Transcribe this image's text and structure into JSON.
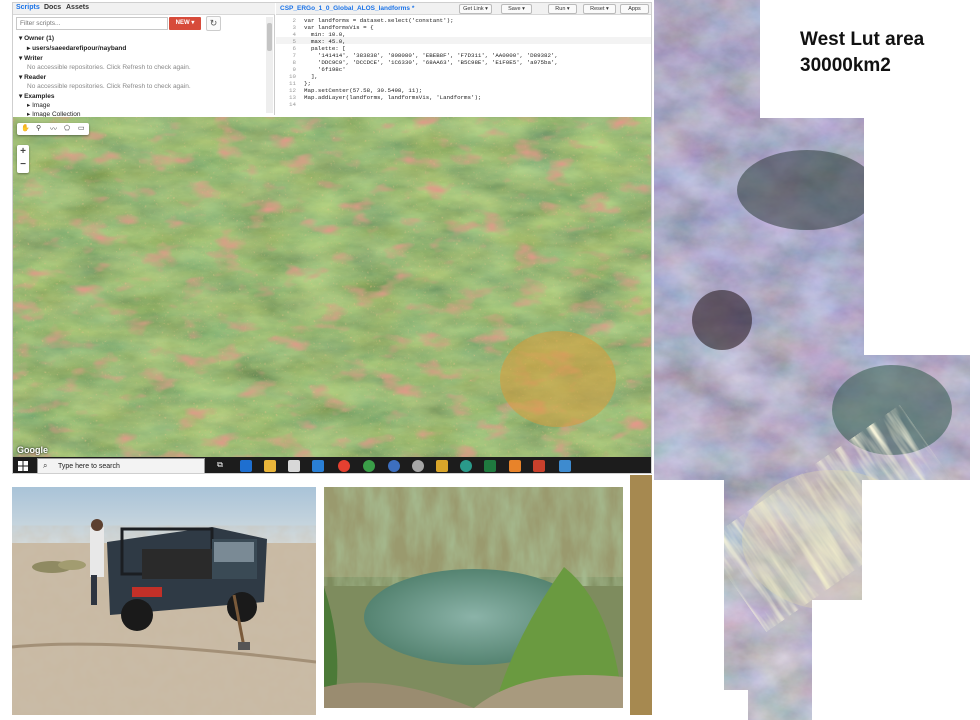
{
  "left_panel": {
    "tabs": [
      "Scripts",
      "Docs",
      "Assets"
    ],
    "filter_placeholder": "Filter scripts...",
    "new_label": "NEW",
    "tree": [
      {
        "text": "Owner (1)",
        "style": "b"
      },
      {
        "text": "users/saeedarefipour/nayband",
        "style": "i1 b"
      },
      {
        "text": "Writer",
        "style": "b"
      },
      {
        "text": "No accessible repositories. Click Refresh to check again.",
        "style": "g"
      },
      {
        "text": "Reader",
        "style": "b"
      },
      {
        "text": "No accessible repositories. Click Refresh to check again.",
        "style": "g"
      },
      {
        "text": "Examples",
        "style": "b"
      },
      {
        "text": "Image",
        "style": "i1"
      },
      {
        "text": "Image Collection",
        "style": "i1"
      }
    ]
  },
  "editor": {
    "file_name": "CSP_ERGo_1_0_Global_ALOS_landforms *",
    "buttons": [
      "Get Link",
      "Save",
      "Run",
      "Reset",
      "Apps"
    ],
    "line_numbers": [
      "2",
      "3",
      "4",
      "5",
      "6",
      "7",
      "8",
      "9",
      "10",
      "11",
      "12",
      "13",
      "14"
    ],
    "code_lines": [
      "var landforms = dataset.select('constant');",
      "var landformsVis = {",
      "  min: 10.0,",
      "  max: 45.0,",
      "  palette: [",
      "    '141414', '383838', '808080', 'EBEB8F', 'F7D311', 'AA0000', 'D89382',",
      "    'DDC9C9', 'DCCDCE', '1C6330', '68AA63', 'B5C98E', 'E1F0E5', 'a975ba',",
      "    '6f198c'",
      "  ],",
      "};",
      "Map.setCenter(57.58, 30.5498, 11);",
      "Map.addLayer(landforms, landformsVis, 'Landforms');",
      ""
    ]
  },
  "map": {
    "tool_icons": [
      "hand-icon",
      "marker-icon",
      "line-icon",
      "polygon-icon",
      "rectangle-icon"
    ],
    "zoom_in": "+",
    "zoom_out": "−",
    "attribution": "Google"
  },
  "taskbar": {
    "search_placeholder": "Type here to search",
    "apps": [
      "task-view",
      "edge",
      "file-explorer",
      "store",
      "mail",
      "chrome",
      "google-earth",
      "app-blue",
      "app-globe",
      "app-grid",
      "app-teal",
      "excel",
      "app-orange",
      "powerpoint",
      "app-map"
    ]
  },
  "satellite": {
    "title_line1": "West Lut area",
    "title_line2": "30000km2"
  }
}
